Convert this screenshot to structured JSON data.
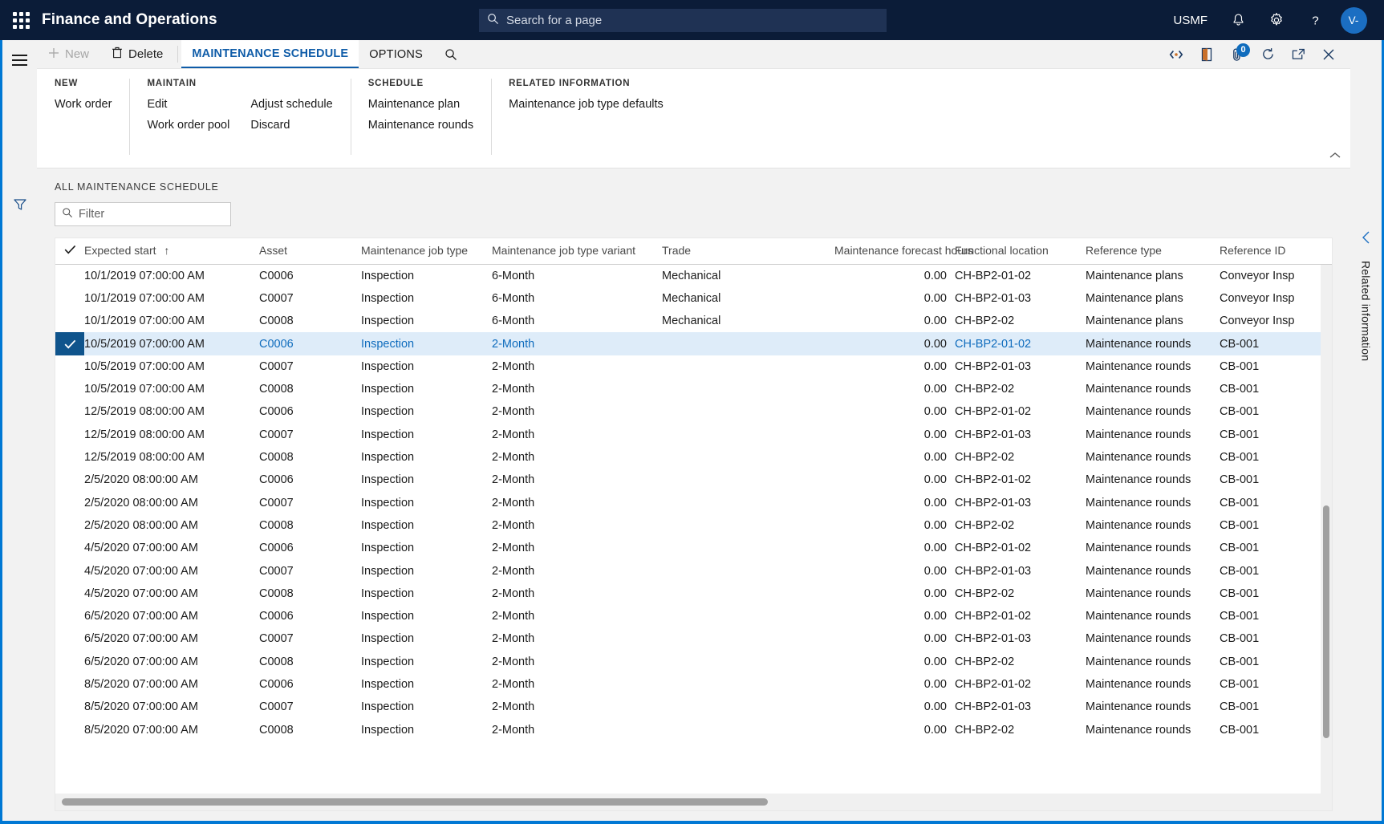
{
  "topnav": {
    "brand": "Finance and Operations",
    "waffle_icon": "app-launcher-icon",
    "search": {
      "placeholder": "Search for a page",
      "value": "",
      "icon": "search-icon"
    },
    "company": "USMF",
    "notifications_icon": "bell-icon",
    "settings_icon": "gear-icon",
    "help_icon": "question-mark-icon",
    "avatar_initials": "V-"
  },
  "leftrail": {
    "menu_icon": "hamburger-menu-icon",
    "filter_icon": "funnel-filter-icon"
  },
  "actionpane": {
    "new_label": "New",
    "new_icon": "plus-icon",
    "delete_label": "Delete",
    "delete_icon": "trash-icon",
    "tabs": [
      {
        "label": "MAINTENANCE SCHEDULE",
        "active": true
      },
      {
        "label": "OPTIONS",
        "active": false
      }
    ],
    "search_icon": "search-icon",
    "right_icons": [
      {
        "name": "developer-tools-icon",
        "badge": null
      },
      {
        "name": "office-app-icon",
        "badge": null
      },
      {
        "name": "attachments-icon",
        "badge": "0"
      },
      {
        "name": "refresh-icon",
        "badge": null
      },
      {
        "name": "open-in-new-window-icon",
        "badge": null
      },
      {
        "name": "close-icon",
        "badge": null
      }
    ]
  },
  "ribbon": {
    "collapse_icon": "chevron-up-icon",
    "groups": [
      {
        "title": "NEW",
        "columns": [
          {
            "items": [
              "Work order"
            ]
          }
        ]
      },
      {
        "title": "MAINTAIN",
        "columns": [
          {
            "items": [
              "Edit",
              "Work order pool"
            ]
          },
          {
            "items": [
              "Adjust schedule",
              "Discard"
            ]
          }
        ]
      },
      {
        "title": "SCHEDULE",
        "columns": [
          {
            "items": [
              "Maintenance plan",
              "Maintenance rounds"
            ]
          }
        ]
      },
      {
        "title": "RELATED INFORMATION",
        "columns": [
          {
            "items": [
              "Maintenance job type defaults"
            ]
          }
        ]
      }
    ]
  },
  "grid": {
    "caption": "ALL MAINTENANCE SCHEDULE",
    "filter": {
      "placeholder": "Filter",
      "value": "",
      "icon": "search-icon"
    },
    "select_all_icon": "checkmark-icon",
    "sort_indicator": "↑",
    "columns": [
      "Expected start",
      "Asset",
      "Maintenance job type",
      "Maintenance job type variant",
      "Trade",
      "Maintenance forecast hours",
      "Functional location",
      "Reference type",
      "Reference ID"
    ],
    "selected_row_index": 3,
    "rows": [
      {
        "expected_start": "10/1/2019 07:00:00 AM",
        "asset": "C0006",
        "job_type": "Inspection",
        "variant": "6-Month",
        "trade": "Mechanical",
        "forecast_hours": "0.00",
        "functional_location": "CH-BP2-01-02",
        "reference_type": "Maintenance plans",
        "reference_id": "Conveyor Insp"
      },
      {
        "expected_start": "10/1/2019 07:00:00 AM",
        "asset": "C0007",
        "job_type": "Inspection",
        "variant": "6-Month",
        "trade": "Mechanical",
        "forecast_hours": "0.00",
        "functional_location": "CH-BP2-01-03",
        "reference_type": "Maintenance plans",
        "reference_id": "Conveyor Insp"
      },
      {
        "expected_start": "10/1/2019 07:00:00 AM",
        "asset": "C0008",
        "job_type": "Inspection",
        "variant": "6-Month",
        "trade": "Mechanical",
        "forecast_hours": "0.00",
        "functional_location": "CH-BP2-02",
        "reference_type": "Maintenance plans",
        "reference_id": "Conveyor Insp"
      },
      {
        "expected_start": "10/5/2019 07:00:00 AM",
        "asset": "C0006",
        "job_type": "Inspection",
        "variant": "2-Month",
        "trade": "",
        "forecast_hours": "0.00",
        "functional_location": "CH-BP2-01-02",
        "reference_type": "Maintenance rounds",
        "reference_id": "CB-001"
      },
      {
        "expected_start": "10/5/2019 07:00:00 AM",
        "asset": "C0007",
        "job_type": "Inspection",
        "variant": "2-Month",
        "trade": "",
        "forecast_hours": "0.00",
        "functional_location": "CH-BP2-01-03",
        "reference_type": "Maintenance rounds",
        "reference_id": "CB-001"
      },
      {
        "expected_start": "10/5/2019 07:00:00 AM",
        "asset": "C0008",
        "job_type": "Inspection",
        "variant": "2-Month",
        "trade": "",
        "forecast_hours": "0.00",
        "functional_location": "CH-BP2-02",
        "reference_type": "Maintenance rounds",
        "reference_id": "CB-001"
      },
      {
        "expected_start": "12/5/2019 08:00:00 AM",
        "asset": "C0006",
        "job_type": "Inspection",
        "variant": "2-Month",
        "trade": "",
        "forecast_hours": "0.00",
        "functional_location": "CH-BP2-01-02",
        "reference_type": "Maintenance rounds",
        "reference_id": "CB-001"
      },
      {
        "expected_start": "12/5/2019 08:00:00 AM",
        "asset": "C0007",
        "job_type": "Inspection",
        "variant": "2-Month",
        "trade": "",
        "forecast_hours": "0.00",
        "functional_location": "CH-BP2-01-03",
        "reference_type": "Maintenance rounds",
        "reference_id": "CB-001"
      },
      {
        "expected_start": "12/5/2019 08:00:00 AM",
        "asset": "C0008",
        "job_type": "Inspection",
        "variant": "2-Month",
        "trade": "",
        "forecast_hours": "0.00",
        "functional_location": "CH-BP2-02",
        "reference_type": "Maintenance rounds",
        "reference_id": "CB-001"
      },
      {
        "expected_start": "2/5/2020 08:00:00 AM",
        "asset": "C0006",
        "job_type": "Inspection",
        "variant": "2-Month",
        "trade": "",
        "forecast_hours": "0.00",
        "functional_location": "CH-BP2-01-02",
        "reference_type": "Maintenance rounds",
        "reference_id": "CB-001"
      },
      {
        "expected_start": "2/5/2020 08:00:00 AM",
        "asset": "C0007",
        "job_type": "Inspection",
        "variant": "2-Month",
        "trade": "",
        "forecast_hours": "0.00",
        "functional_location": "CH-BP2-01-03",
        "reference_type": "Maintenance rounds",
        "reference_id": "CB-001"
      },
      {
        "expected_start": "2/5/2020 08:00:00 AM",
        "asset": "C0008",
        "job_type": "Inspection",
        "variant": "2-Month",
        "trade": "",
        "forecast_hours": "0.00",
        "functional_location": "CH-BP2-02",
        "reference_type": "Maintenance rounds",
        "reference_id": "CB-001"
      },
      {
        "expected_start": "4/5/2020 07:00:00 AM",
        "asset": "C0006",
        "job_type": "Inspection",
        "variant": "2-Month",
        "trade": "",
        "forecast_hours": "0.00",
        "functional_location": "CH-BP2-01-02",
        "reference_type": "Maintenance rounds",
        "reference_id": "CB-001"
      },
      {
        "expected_start": "4/5/2020 07:00:00 AM",
        "asset": "C0007",
        "job_type": "Inspection",
        "variant": "2-Month",
        "trade": "",
        "forecast_hours": "0.00",
        "functional_location": "CH-BP2-01-03",
        "reference_type": "Maintenance rounds",
        "reference_id": "CB-001"
      },
      {
        "expected_start": "4/5/2020 07:00:00 AM",
        "asset": "C0008",
        "job_type": "Inspection",
        "variant": "2-Month",
        "trade": "",
        "forecast_hours": "0.00",
        "functional_location": "CH-BP2-02",
        "reference_type": "Maintenance rounds",
        "reference_id": "CB-001"
      },
      {
        "expected_start": "6/5/2020 07:00:00 AM",
        "asset": "C0006",
        "job_type": "Inspection",
        "variant": "2-Month",
        "trade": "",
        "forecast_hours": "0.00",
        "functional_location": "CH-BP2-01-02",
        "reference_type": "Maintenance rounds",
        "reference_id": "CB-001"
      },
      {
        "expected_start": "6/5/2020 07:00:00 AM",
        "asset": "C0007",
        "job_type": "Inspection",
        "variant": "2-Month",
        "trade": "",
        "forecast_hours": "0.00",
        "functional_location": "CH-BP2-01-03",
        "reference_type": "Maintenance rounds",
        "reference_id": "CB-001"
      },
      {
        "expected_start": "6/5/2020 07:00:00 AM",
        "asset": "C0008",
        "job_type": "Inspection",
        "variant": "2-Month",
        "trade": "",
        "forecast_hours": "0.00",
        "functional_location": "CH-BP2-02",
        "reference_type": "Maintenance rounds",
        "reference_id": "CB-001"
      },
      {
        "expected_start": "8/5/2020 07:00:00 AM",
        "asset": "C0006",
        "job_type": "Inspection",
        "variant": "2-Month",
        "trade": "",
        "forecast_hours": "0.00",
        "functional_location": "CH-BP2-01-02",
        "reference_type": "Maintenance rounds",
        "reference_id": "CB-001"
      },
      {
        "expected_start": "8/5/2020 07:00:00 AM",
        "asset": "C0007",
        "job_type": "Inspection",
        "variant": "2-Month",
        "trade": "",
        "forecast_hours": "0.00",
        "functional_location": "CH-BP2-01-03",
        "reference_type": "Maintenance rounds",
        "reference_id": "CB-001"
      },
      {
        "expected_start": "8/5/2020 07:00:00 AM",
        "asset": "C0008",
        "job_type": "Inspection",
        "variant": "2-Month",
        "trade": "",
        "forecast_hours": "0.00",
        "functional_location": "CH-BP2-02",
        "reference_type": "Maintenance rounds",
        "reference_id": "CB-001"
      }
    ]
  },
  "rightrail": {
    "collapse_icon": "chevron-left-icon",
    "label": "Related information"
  },
  "colors": {
    "accent": "#0078d4",
    "nav_bg": "#0b1c38",
    "link": "#0f6cbd",
    "selected_row": "#deecf9"
  }
}
